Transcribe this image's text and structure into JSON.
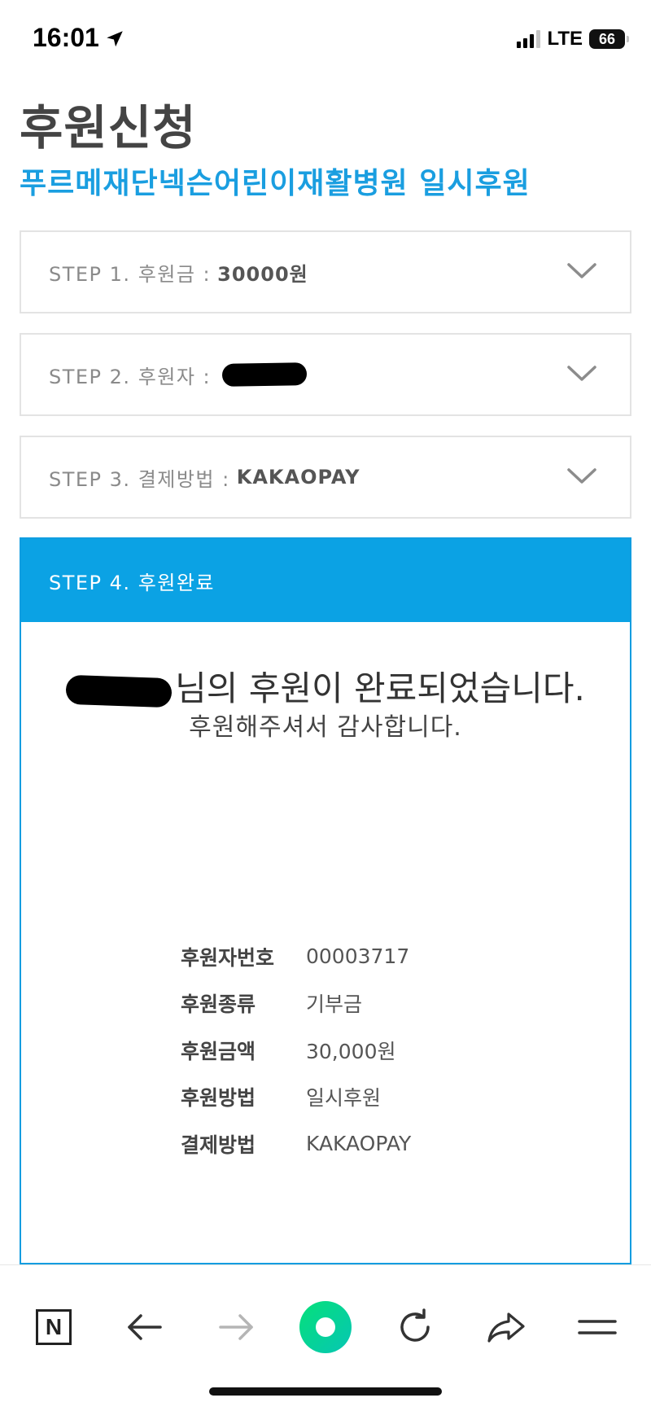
{
  "status_bar": {
    "time": "16:01",
    "network": "LTE",
    "battery": "66"
  },
  "page": {
    "title": "후원신청",
    "subtitle": "푸르메재단넥슨어린이재활병원 일시후원"
  },
  "steps": [
    {
      "label": "STEP 1. 후원금 :",
      "value": "30000원"
    },
    {
      "label": "STEP 2. 후원자 :",
      "value": ""
    },
    {
      "label": "STEP 3. 결제방법 :",
      "value": "KAKAOPAY"
    }
  ],
  "completion": {
    "header": "STEP 4. 후원완료",
    "message": "님의 후원이 완료되었습니다.",
    "thanks": "후원해주셔서 감사합니다.",
    "details": [
      {
        "key": "후원자번호",
        "value": "00003717"
      },
      {
        "key": "후원종류",
        "value": "기부금"
      },
      {
        "key": "후원금액",
        "value": "30,000원"
      },
      {
        "key": "후원방법",
        "value": "일시후원"
      },
      {
        "key": "결제방법",
        "value": "KAKAOPAY"
      }
    ]
  },
  "toolbar": {
    "n_label": "N",
    "icons": [
      "naver-n-icon",
      "back-arrow-icon",
      "forward-arrow-icon",
      "green-dot-home-icon",
      "reload-icon",
      "share-icon",
      "menu-icon"
    ]
  },
  "colors": {
    "accent_blue": "#0ba2e4",
    "title_gray": "#444444",
    "subtitle_blue": "#1a9ee0",
    "home_green": "#05e07a"
  }
}
